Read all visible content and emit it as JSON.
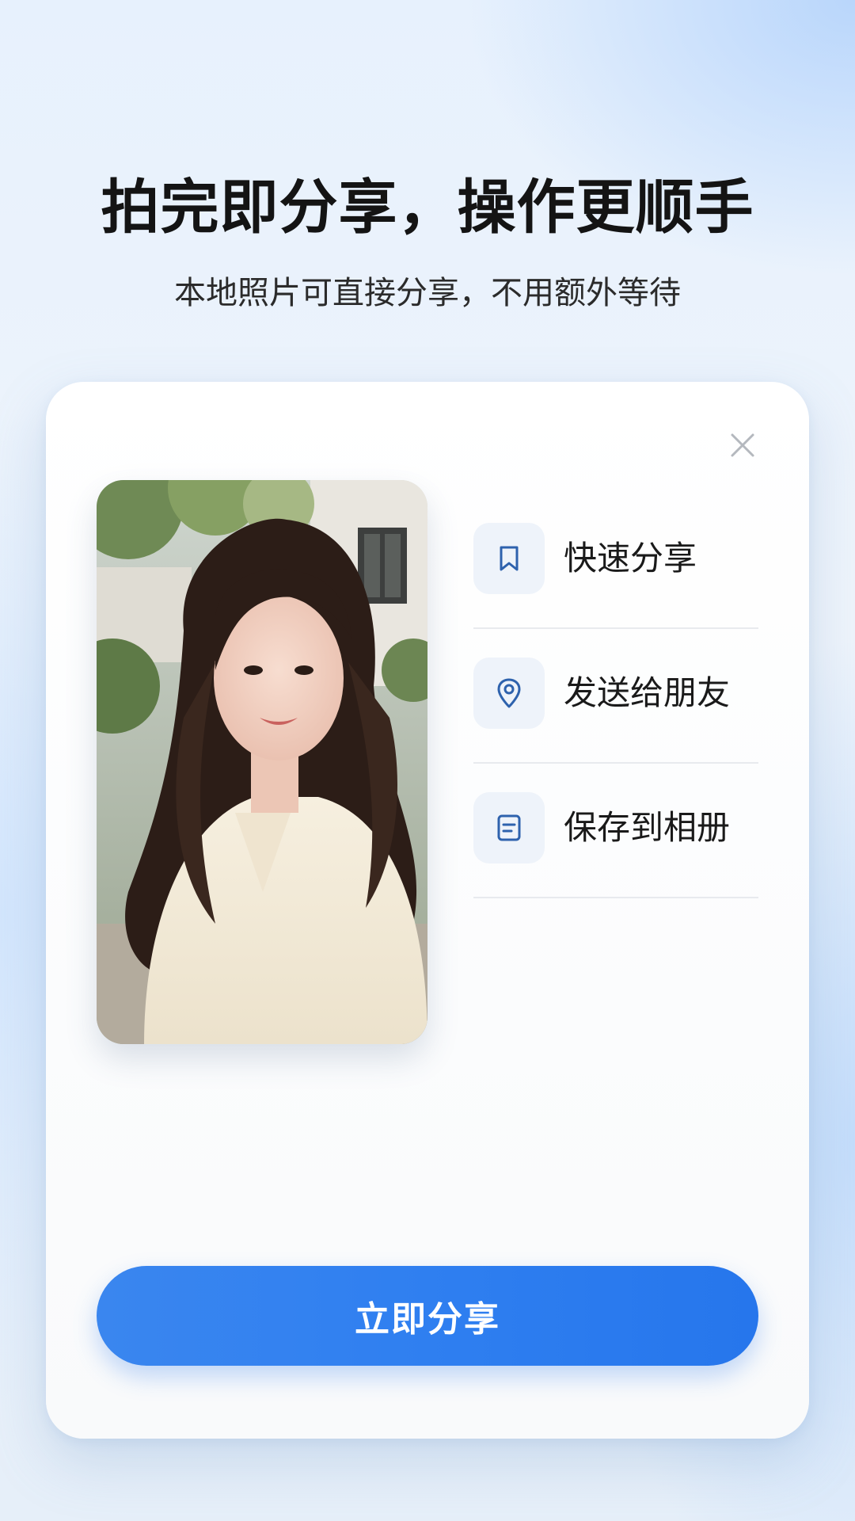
{
  "header": {
    "title": "拍完即分享，操作更顺手",
    "subtitle": "本地照片可直接分享，不用额外等待"
  },
  "dialog": {
    "close_icon": "close-icon",
    "photo": "portrait-photo",
    "options": [
      {
        "label": "快速分享",
        "icon": "bookmark-icon"
      },
      {
        "label": "发送给朋友",
        "icon": "location-pin-icon"
      },
      {
        "label": "保存到相册",
        "icon": "document-icon"
      }
    ],
    "primary_button_label": "立即分享"
  },
  "colors": {
    "accent": "#2f7ff0",
    "icon_blue": "#2e62ad",
    "icon_bg": "#eef3fa",
    "title_text": "#141414"
  }
}
